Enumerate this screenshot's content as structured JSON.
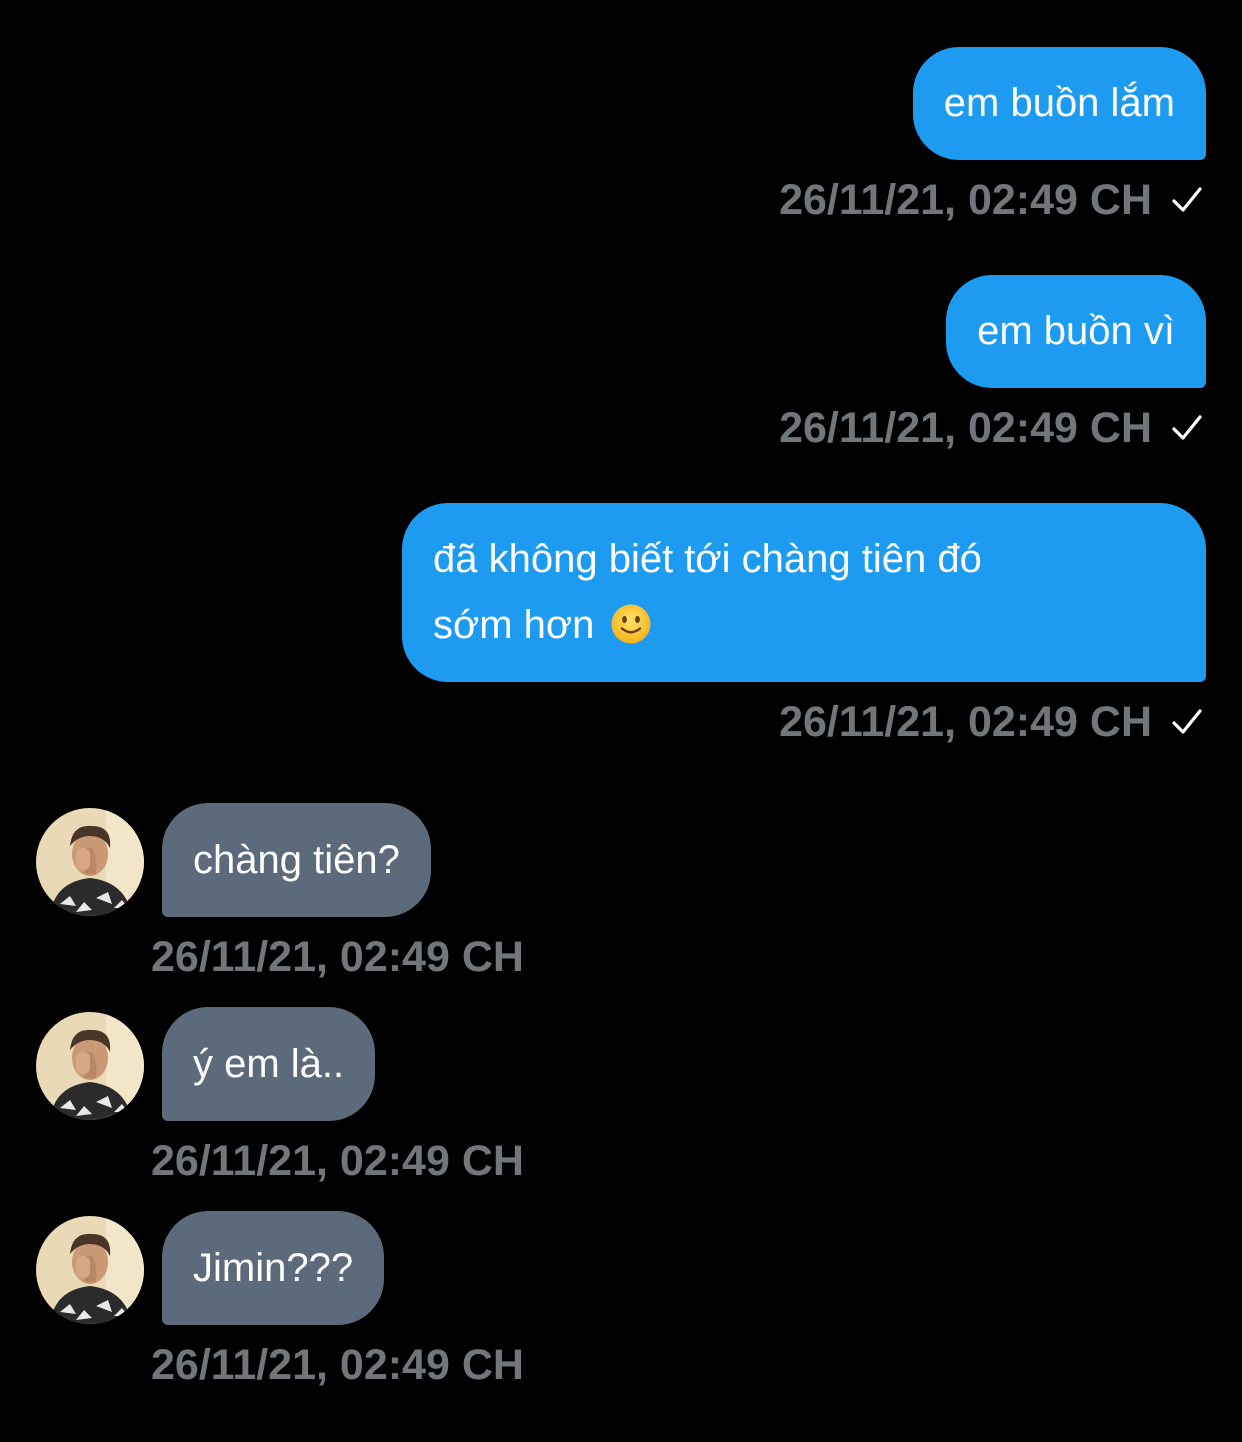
{
  "conversation": {
    "messages": [
      {
        "direction": "outgoing",
        "text": "em buồn lắm",
        "timestamp": "26/11/21, 02:49 CH",
        "status_icon": "check-icon"
      },
      {
        "direction": "outgoing",
        "text": "em buồn vì",
        "timestamp": "26/11/21, 02:49 CH",
        "status_icon": "check-icon"
      },
      {
        "direction": "outgoing",
        "text_line1": "đã không biết tới chàng tiên đó",
        "text_line2": "sớm hơn",
        "emoji": "slightly-smiling-face",
        "timestamp": "26/11/21, 02:49 CH",
        "status_icon": "check-icon"
      },
      {
        "direction": "incoming",
        "text": "chàng tiên?",
        "timestamp": "26/11/21, 02:49 CH"
      },
      {
        "direction": "incoming",
        "text": "ý em là..",
        "timestamp": "26/11/21, 02:49 CH"
      },
      {
        "direction": "incoming",
        "text": "Jimin???",
        "timestamp": "26/11/21, 02:49 CH"
      }
    ]
  },
  "colors": {
    "background": "#000000",
    "outgoing_bubble": "#1d9bf0",
    "incoming_bubble": "#5b6b7c",
    "timestamp": "#71767b",
    "check": "#ffffff"
  }
}
